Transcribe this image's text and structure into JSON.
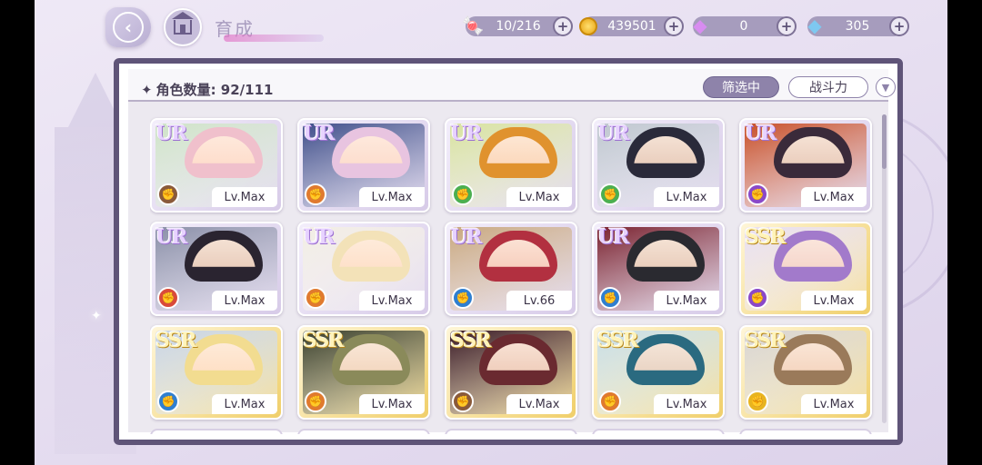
{
  "header": {
    "title": "育成",
    "resources": [
      {
        "name": "candy",
        "icon": "candy-icon",
        "value": "10/216"
      },
      {
        "name": "gold",
        "icon": "coin-icon",
        "value": "439501"
      },
      {
        "name": "pink-diamond",
        "icon": "pink-diamond-icon",
        "value": "0"
      },
      {
        "name": "blue-diamond",
        "icon": "blue-diamond-icon",
        "value": "305"
      }
    ]
  },
  "panel": {
    "count_label": "角色数量: 92/111",
    "filter_label": "筛选中",
    "sort_label": "战斗力"
  },
  "cards": [
    {
      "rarity": "UR",
      "level": "Lv.Max",
      "element": "brown",
      "elem_color": "#8a5a3a",
      "hair": "#f0c0cc",
      "bg": "#cfe3c8"
    },
    {
      "rarity": "UR",
      "level": "Lv.Max",
      "element": "orange",
      "elem_color": "#e07a2e",
      "hair": "#e8c4e0",
      "bg": "#3f4e8a"
    },
    {
      "rarity": "UR",
      "level": "Lv.Max",
      "element": "green",
      "elem_color": "#4caf50",
      "hair": "#e0922e",
      "bg": "#d8e2a0"
    },
    {
      "rarity": "UR",
      "level": "Lv.Max",
      "element": "green",
      "elem_color": "#4caf50",
      "hair": "#2a2a3a",
      "bg": "#bfc7cf"
    },
    {
      "rarity": "UR",
      "level": "Lv.Max",
      "element": "purple",
      "elem_color": "#8b49c8",
      "hair": "#3a2a3a",
      "bg": "#c8502a"
    },
    {
      "rarity": "UR",
      "level": "Lv.Max",
      "element": "red",
      "elem_color": "#d94a3a",
      "hair": "#2a2430",
      "bg": "#8a8fa8"
    },
    {
      "rarity": "UR",
      "level": "Lv.Max",
      "element": "orange",
      "elem_color": "#e07a2e",
      "hair": "#f3e2b8",
      "bg": "#f2ede4"
    },
    {
      "rarity": "UR",
      "level": "Lv.66",
      "element": "blue",
      "elem_color": "#2f7fd0",
      "hair": "#b23040",
      "bg": "#c9a880"
    },
    {
      "rarity": "UR",
      "level": "Lv.Max",
      "element": "blue",
      "elem_color": "#2f7fd0",
      "hair": "#2a2a30",
      "bg": "#7a2230"
    },
    {
      "rarity": "SSR",
      "level": "Lv.Max",
      "element": "purple",
      "elem_color": "#8b49c8",
      "hair": "#a27acb",
      "bg": "#e8dff0"
    },
    {
      "rarity": "SSR",
      "level": "Lv.Max",
      "element": "blue",
      "elem_color": "#2f7fd0",
      "hair": "#f2dc90",
      "bg": "#c8d4e4"
    },
    {
      "rarity": "SSR",
      "level": "Lv.Max",
      "element": "orange",
      "elem_color": "#e07a2e",
      "hair": "#8a8a5a",
      "bg": "#3a3f2a"
    },
    {
      "rarity": "SSR",
      "level": "Lv.Max",
      "element": "brown",
      "elem_color": "#8a5a3a",
      "hair": "#6a2a30",
      "bg": "#3a1a24"
    },
    {
      "rarity": "SSR",
      "level": "Lv.Max",
      "element": "orange",
      "elem_color": "#e07a2e",
      "hair": "#2a6a80",
      "bg": "#c8dde4"
    },
    {
      "rarity": "SSR",
      "level": "Lv.Max",
      "element": "yellow",
      "elem_color": "#e8b420",
      "hair": "#9a7a5a",
      "bg": "#d8d4d0"
    }
  ]
}
